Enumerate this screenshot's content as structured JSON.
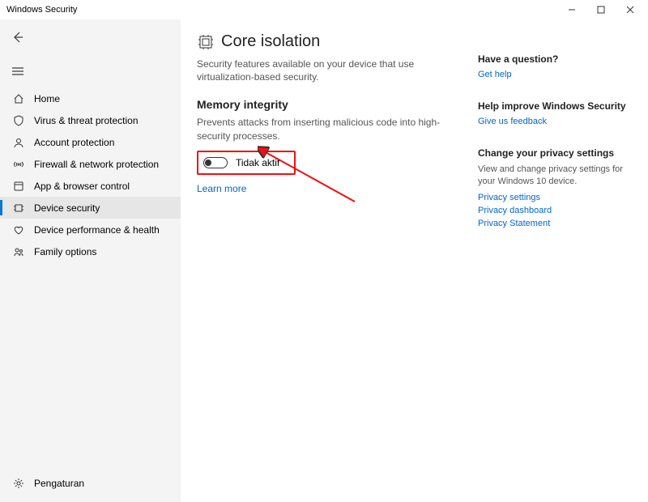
{
  "window": {
    "title": "Windows Security"
  },
  "sidebar": {
    "items": [
      {
        "label": "Home"
      },
      {
        "label": "Virus & threat protection"
      },
      {
        "label": "Account protection"
      },
      {
        "label": "Firewall & network protection"
      },
      {
        "label": "App & browser control"
      },
      {
        "label": "Device security"
      },
      {
        "label": "Device performance & health"
      },
      {
        "label": "Family options"
      }
    ],
    "settings_label": "Pengaturan"
  },
  "page": {
    "title": "Core isolation",
    "description": "Security features available on your device that use virtualization-based security.",
    "section": {
      "title": "Memory integrity",
      "description": "Prevents attacks from inserting malicious code into high-security processes.",
      "toggle_state": "Tidak aktif",
      "learn_more": "Learn more"
    }
  },
  "right": {
    "question": {
      "title": "Have a question?",
      "link": "Get help"
    },
    "improve": {
      "title": "Help improve Windows Security",
      "link": "Give us feedback"
    },
    "privacy": {
      "title": "Change your privacy settings",
      "text": "View and change privacy settings for your Windows 10 device.",
      "links": [
        "Privacy settings",
        "Privacy dashboard",
        "Privacy Statement"
      ]
    }
  }
}
